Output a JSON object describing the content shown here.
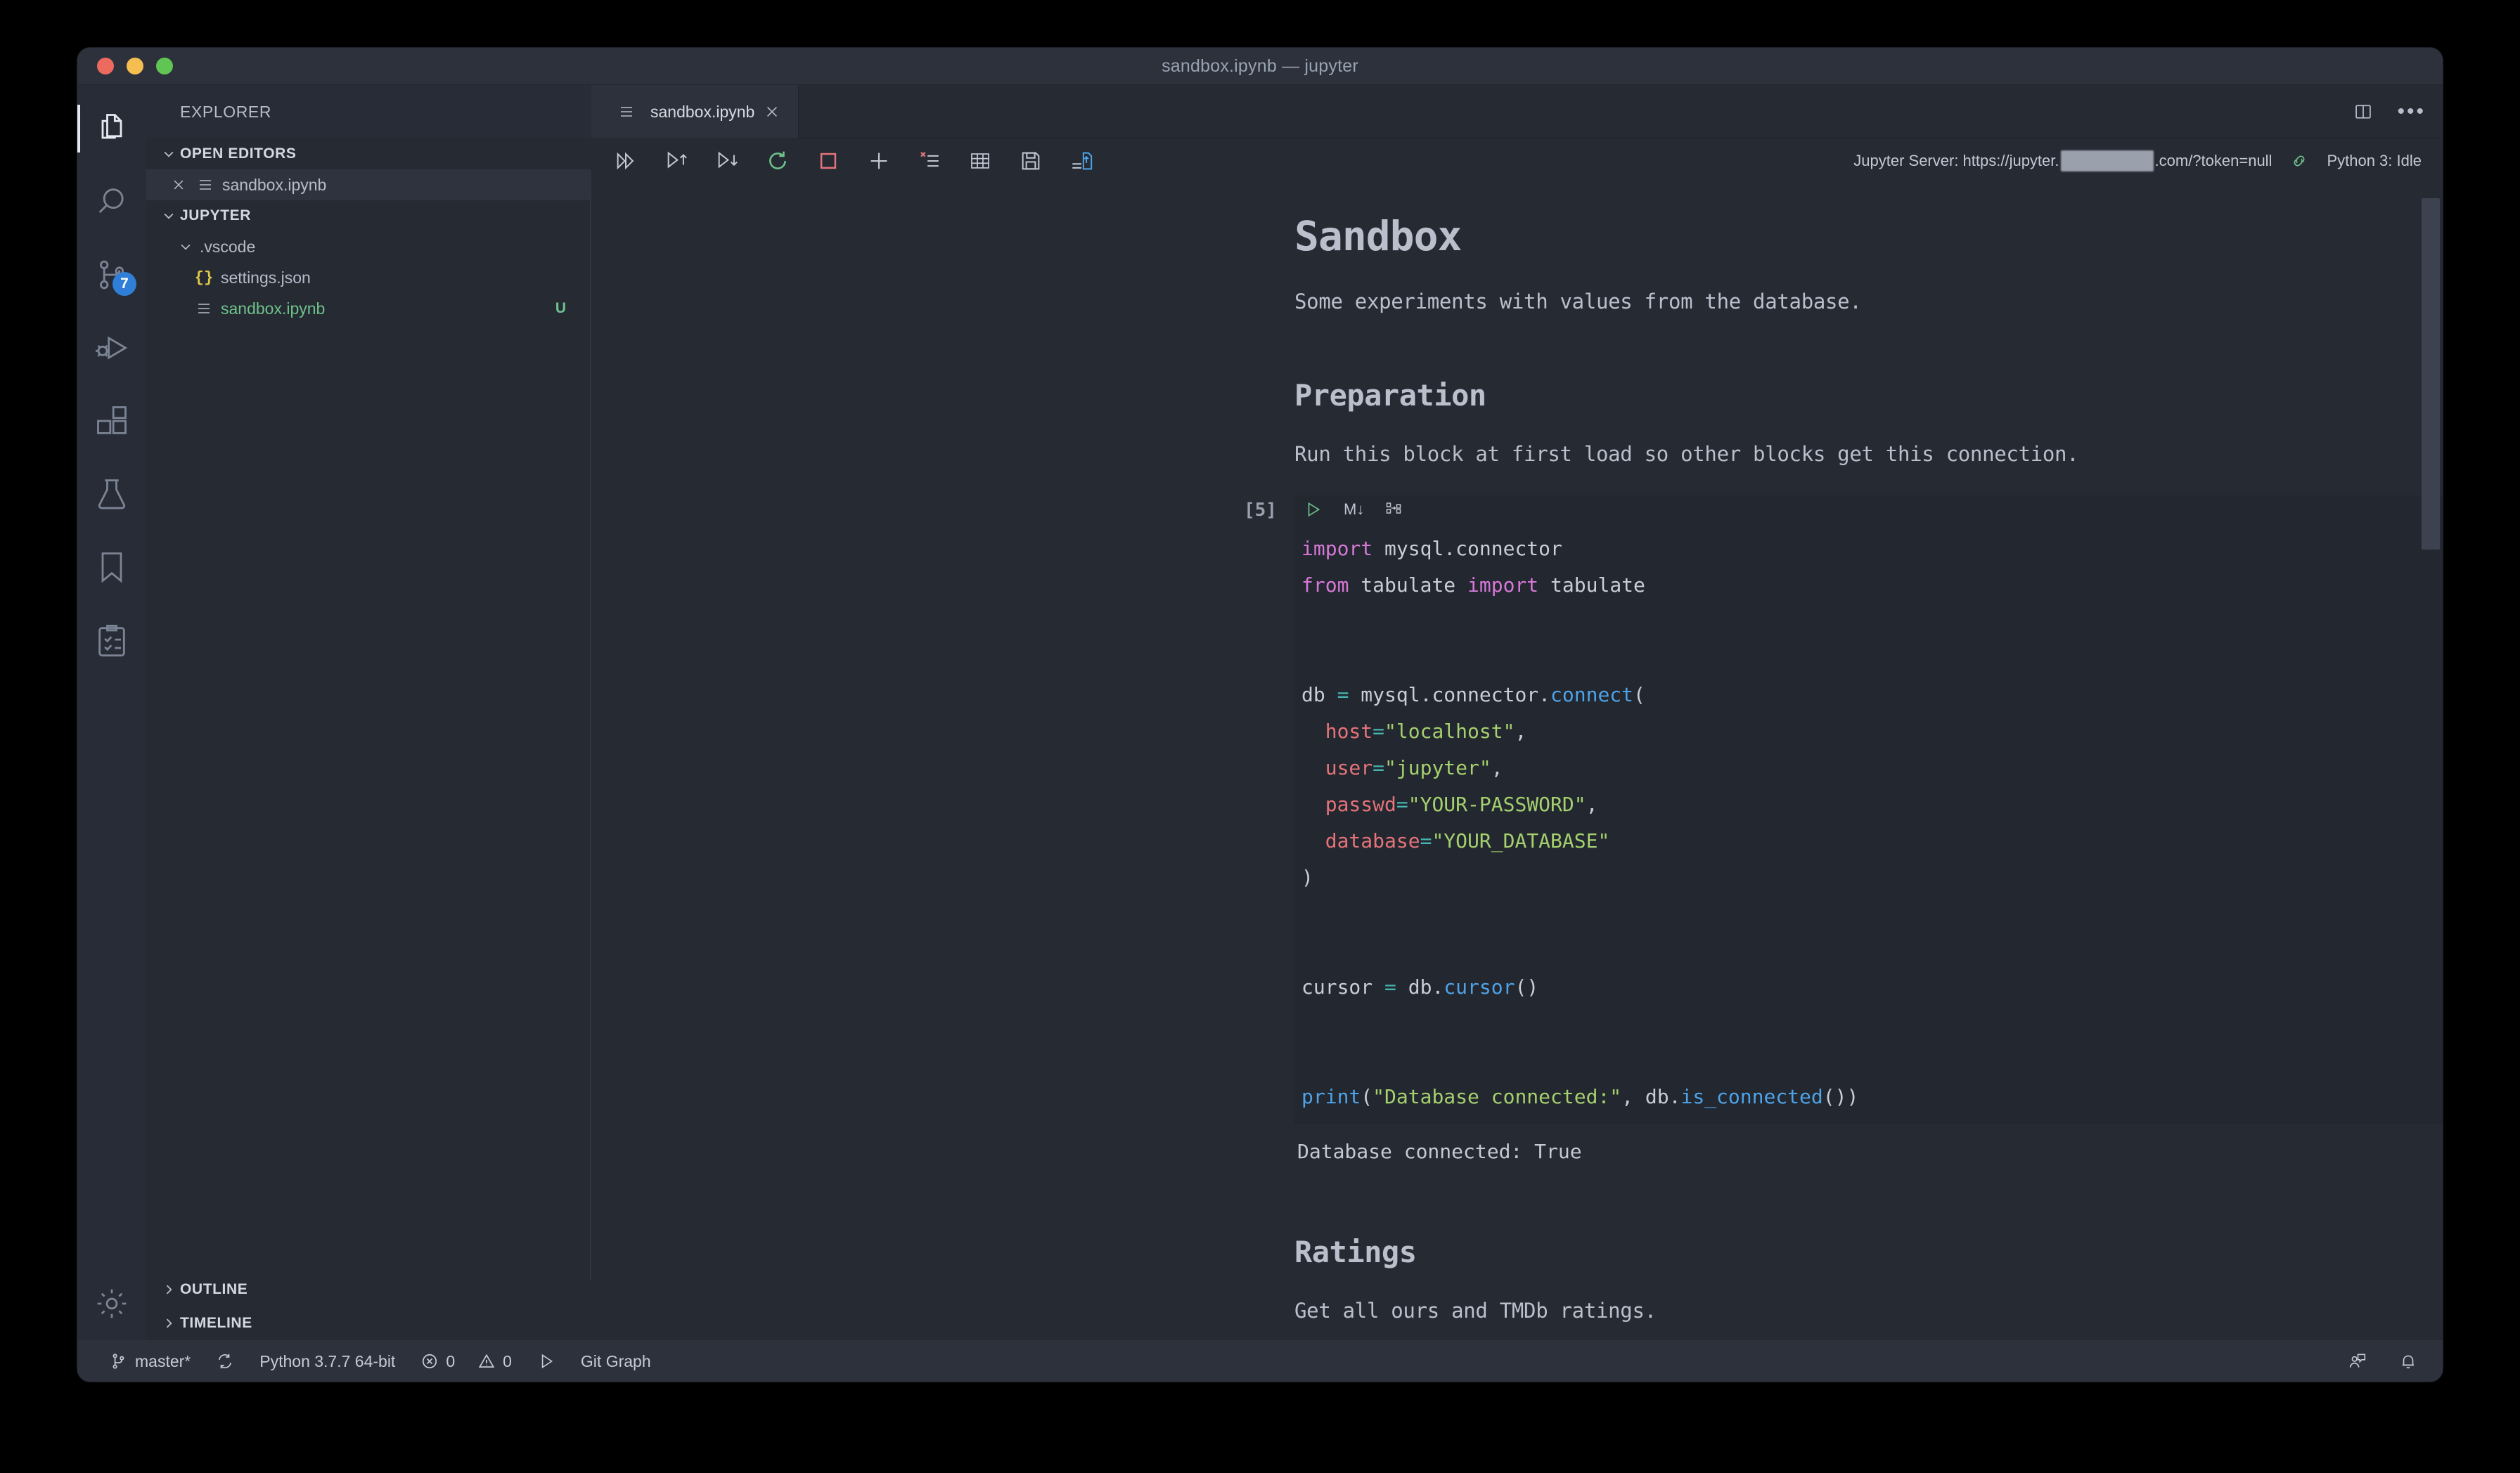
{
  "window": {
    "title": "sandbox.ipynb — jupyter",
    "traffic_lights": [
      "close-red",
      "minimize-yellow",
      "zoom-green"
    ]
  },
  "activitybar": {
    "items": [
      {
        "name": "explorer",
        "icon": "files-icon",
        "active": true,
        "badge": null
      },
      {
        "name": "search",
        "icon": "search-icon",
        "active": false,
        "badge": null
      },
      {
        "name": "source-control",
        "icon": "source-control-icon",
        "active": false,
        "badge": "7"
      },
      {
        "name": "run-and-debug",
        "icon": "run-debug-icon",
        "active": false,
        "badge": null
      },
      {
        "name": "extensions",
        "icon": "extensions-icon",
        "active": false,
        "badge": null
      },
      {
        "name": "testing",
        "icon": "beaker-icon",
        "active": false,
        "badge": null
      },
      {
        "name": "bookmarks",
        "icon": "bookmark-icon",
        "active": false,
        "badge": null
      },
      {
        "name": "todo-tree",
        "icon": "checklist-icon",
        "active": false,
        "badge": null
      }
    ],
    "bottom": [
      {
        "name": "manage",
        "icon": "gear-icon"
      }
    ]
  },
  "sidebar": {
    "title": "EXPLORER",
    "open_editors": {
      "label": "OPEN EDITORS",
      "items": [
        {
          "name": "sandbox.ipynb",
          "icon": "notebook-icon",
          "active": true
        }
      ]
    },
    "workspace": {
      "label": "JUPYTER",
      "items": [
        {
          "name": ".vscode",
          "type": "folder",
          "expanded": true,
          "indent": 1
        },
        {
          "name": "settings.json",
          "type": "json",
          "indent": 2,
          "git": ""
        },
        {
          "name": "sandbox.ipynb",
          "type": "notebook",
          "indent": 1,
          "git": "U",
          "untracked": true
        }
      ]
    },
    "bottom_sections": [
      {
        "label": "OUTLINE"
      },
      {
        "label": "TIMELINE"
      }
    ]
  },
  "editor": {
    "tabs": [
      {
        "label": "sandbox.ipynb",
        "icon": "notebook-icon",
        "active": true,
        "close": "×"
      }
    ],
    "actions": [
      {
        "name": "split-editor",
        "icon": "split-editor-icon"
      },
      {
        "name": "more-actions",
        "icon": "ellipsis-icon",
        "glyph": "•••"
      }
    ]
  },
  "notebook_toolbar": {
    "buttons": [
      {
        "name": "run-all",
        "icon": "run-all-icon"
      },
      {
        "name": "run-above",
        "icon": "run-above-icon"
      },
      {
        "name": "run-below",
        "icon": "run-below-icon"
      },
      {
        "name": "restart-kernel",
        "icon": "restart-icon",
        "color": "#6fc28c"
      },
      {
        "name": "interrupt-kernel",
        "icon": "stop-square-icon",
        "color": "#e5737a"
      },
      {
        "name": "add-cell",
        "icon": "plus-icon"
      },
      {
        "name": "clear-outputs",
        "icon": "clear-outputs-icon"
      },
      {
        "name": "variables",
        "icon": "table-icon"
      },
      {
        "name": "save",
        "icon": "save-icon"
      },
      {
        "name": "export",
        "icon": "export-icon"
      }
    ],
    "server_label": "Jupyter Server: https://jupyter.",
    "server_label_suffix": ".com/?token=null",
    "server_redacted": true,
    "kernel_status": "Python 3: Idle"
  },
  "notebook": {
    "cells": [
      {
        "type": "markdown",
        "style": "h1",
        "text": "Sandbox"
      },
      {
        "type": "markdown",
        "style": "p",
        "text": "Some experiments with values from the database."
      },
      {
        "type": "markdown",
        "style": "h2",
        "text": "Preparation"
      },
      {
        "type": "markdown",
        "style": "p",
        "text": "Run this block at first load so other blocks get this connection."
      },
      {
        "type": "code",
        "exec_count": "[5]",
        "toolbar": [
          {
            "name": "run-cell",
            "icon": "play-icon"
          },
          {
            "name": "change-to-markdown",
            "icon": "markdown-down-icon",
            "glyph": "M↓"
          },
          {
            "name": "split-cell",
            "icon": "split-cell-icon"
          }
        ],
        "source_lines": [
          [
            {
              "t": "kw",
              "s": "import"
            },
            {
              "t": "def",
              "s": " mysql.connector"
            }
          ],
          [
            {
              "t": "kw",
              "s": "from"
            },
            {
              "t": "def",
              "s": " tabulate "
            },
            {
              "t": "kw",
              "s": "import"
            },
            {
              "t": "def",
              "s": " tabulate"
            }
          ],
          [
            {
              "t": "def",
              "s": ""
            }
          ],
          [
            {
              "t": "def",
              "s": ""
            }
          ],
          [
            {
              "t": "def",
              "s": "db "
            },
            {
              "t": "op",
              "s": "="
            },
            {
              "t": "def",
              "s": " mysql.connector."
            },
            {
              "t": "fn",
              "s": "connect"
            },
            {
              "t": "punc",
              "s": "("
            }
          ],
          [
            {
              "t": "def",
              "s": "  "
            },
            {
              "t": "par",
              "s": "host"
            },
            {
              "t": "op",
              "s": "="
            },
            {
              "t": "str",
              "s": "\"localhost\""
            },
            {
              "t": "punc",
              "s": ","
            }
          ],
          [
            {
              "t": "def",
              "s": "  "
            },
            {
              "t": "par",
              "s": "user"
            },
            {
              "t": "op",
              "s": "="
            },
            {
              "t": "str",
              "s": "\"jupyter\""
            },
            {
              "t": "punc",
              "s": ","
            }
          ],
          [
            {
              "t": "def",
              "s": "  "
            },
            {
              "t": "par",
              "s": "passwd"
            },
            {
              "t": "op",
              "s": "="
            },
            {
              "t": "str",
              "s": "\"YOUR-PASSWORD\""
            },
            {
              "t": "punc",
              "s": ","
            }
          ],
          [
            {
              "t": "def",
              "s": "  "
            },
            {
              "t": "par",
              "s": "database"
            },
            {
              "t": "op",
              "s": "="
            },
            {
              "t": "str",
              "s": "\"YOUR_DATABASE\""
            }
          ],
          [
            {
              "t": "punc",
              "s": ")"
            }
          ],
          [
            {
              "t": "def",
              "s": ""
            }
          ],
          [
            {
              "t": "def",
              "s": ""
            }
          ],
          [
            {
              "t": "def",
              "s": "cursor "
            },
            {
              "t": "op",
              "s": "="
            },
            {
              "t": "def",
              "s": " db."
            },
            {
              "t": "fn",
              "s": "cursor"
            },
            {
              "t": "punc",
              "s": "()"
            }
          ],
          [
            {
              "t": "def",
              "s": ""
            }
          ],
          [
            {
              "t": "def",
              "s": ""
            }
          ],
          [
            {
              "t": "fn",
              "s": "print"
            },
            {
              "t": "punc",
              "s": "("
            },
            {
              "t": "str",
              "s": "\"Database connected:\""
            },
            {
              "t": "punc",
              "s": ", "
            },
            {
              "t": "def",
              "s": "db."
            },
            {
              "t": "fn",
              "s": "is_connected"
            },
            {
              "t": "punc",
              "s": "())"
            }
          ]
        ],
        "output_text": "Database connected: True"
      },
      {
        "type": "markdown",
        "style": "h2",
        "text": "Ratings"
      },
      {
        "type": "markdown",
        "style": "p",
        "text": "Get all ours and TMDb ratings."
      }
    ]
  },
  "statusbar": {
    "left": [
      {
        "name": "branch",
        "icon": "git-branch-icon",
        "label": "master*"
      },
      {
        "name": "sync",
        "icon": "sync-icon",
        "label": ""
      },
      {
        "name": "python-interpreter",
        "icon": null,
        "label": "Python 3.7.7 64-bit"
      },
      {
        "name": "problems-errors",
        "icon": "error-icon",
        "label": "0"
      },
      {
        "name": "problems-warnings",
        "icon": "warning-icon",
        "label": "0"
      },
      {
        "name": "run-python-file",
        "icon": "play-icon",
        "label": ""
      },
      {
        "name": "git-graph",
        "icon": null,
        "label": "Git Graph"
      }
    ],
    "right": [
      {
        "name": "feedback",
        "icon": "feedback-icon"
      },
      {
        "name": "notifications",
        "icon": "bell-icon"
      }
    ]
  },
  "colors": {
    "background": "#252a33",
    "chrome": "#2c313c",
    "code_background": "#23272f",
    "accent_blue": "#2f7fd8",
    "green": "#6fc28c",
    "red": "#e5737a",
    "string_green": "#a5d06e",
    "keyword_pink": "#d778d8",
    "function_blue": "#4ea3e8",
    "operator_teal": "#46b6b0"
  }
}
